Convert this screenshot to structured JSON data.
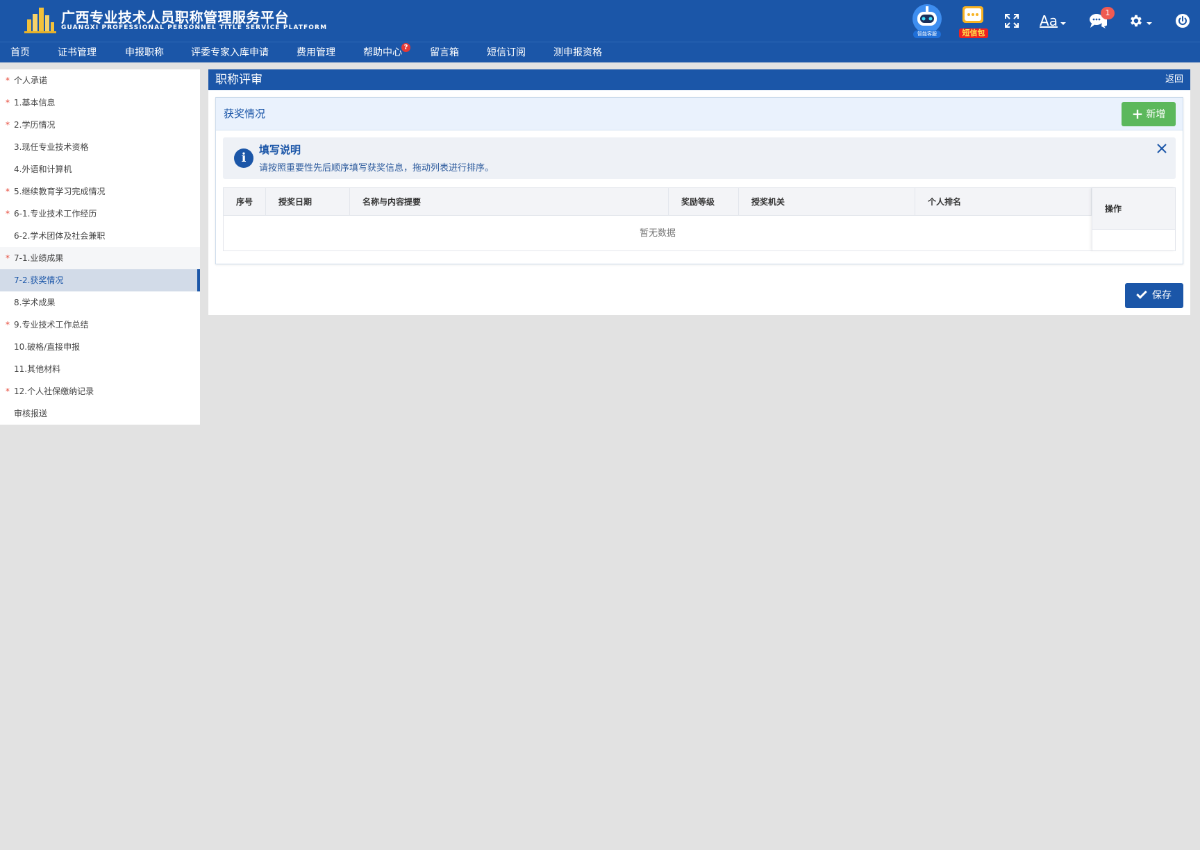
{
  "header": {
    "title_cn": "广西专业技术人员职称管理服务平台",
    "title_en": "GUANGXI PROFESSIONAL PERSONNEL TITLE SERVICE PLATFORM",
    "robot_label": "智能客服",
    "sms_label": "短信包",
    "font_label": "Aa",
    "chat_badge": "1"
  },
  "nav": {
    "items": [
      "首页",
      "证书管理",
      "申报职称",
      "评委专家入库申请",
      "费用管理",
      "帮助中心",
      "留言箱",
      "短信订阅",
      "测申报资格"
    ],
    "help_mark": "?"
  },
  "sidebar": {
    "items": [
      {
        "label": "个人承诺",
        "required": true
      },
      {
        "label": "1.基本信息",
        "required": true
      },
      {
        "label": "2.学历情况",
        "required": true
      },
      {
        "label": "3.现任专业技术资格",
        "required": false
      },
      {
        "label": "4.外语和计算机",
        "required": false
      },
      {
        "label": "5.继续教育学习完成情况",
        "required": true
      },
      {
        "label": "6-1.专业技术工作经历",
        "required": true
      },
      {
        "label": "6-2.学术团体及社会兼职",
        "required": false
      },
      {
        "label": "7-1.业绩成果",
        "required": true
      },
      {
        "label": "7-2.获奖情况",
        "required": false
      },
      {
        "label": "8.学术成果",
        "required": false
      },
      {
        "label": "9.专业技术工作总结",
        "required": true
      },
      {
        "label": "10.破格/直接申报",
        "required": false
      },
      {
        "label": "11.其他材料",
        "required": false
      },
      {
        "label": "12.个人社保缴纳记录",
        "required": true
      },
      {
        "label": "审核报送",
        "required": false
      }
    ],
    "star": "*"
  },
  "main": {
    "title": "职称评审",
    "back_label": "返回",
    "card_title": "获奖情况",
    "add_label": "新增",
    "notice": {
      "title": "填写说明",
      "text": "请按照重要性先后顺序填写获奖信息，拖动列表进行排序。"
    },
    "table": {
      "columns": [
        "序号",
        "授奖日期",
        "名称与内容提要",
        "奖励等级",
        "授奖机关",
        "个人排名"
      ],
      "ops_label": "操作",
      "empty_text": "暂无数据"
    },
    "save_label": "保存"
  },
  "colors": {
    "brand": "#1b56a8",
    "success": "#5cb85c",
    "required": "#e74c3c"
  }
}
